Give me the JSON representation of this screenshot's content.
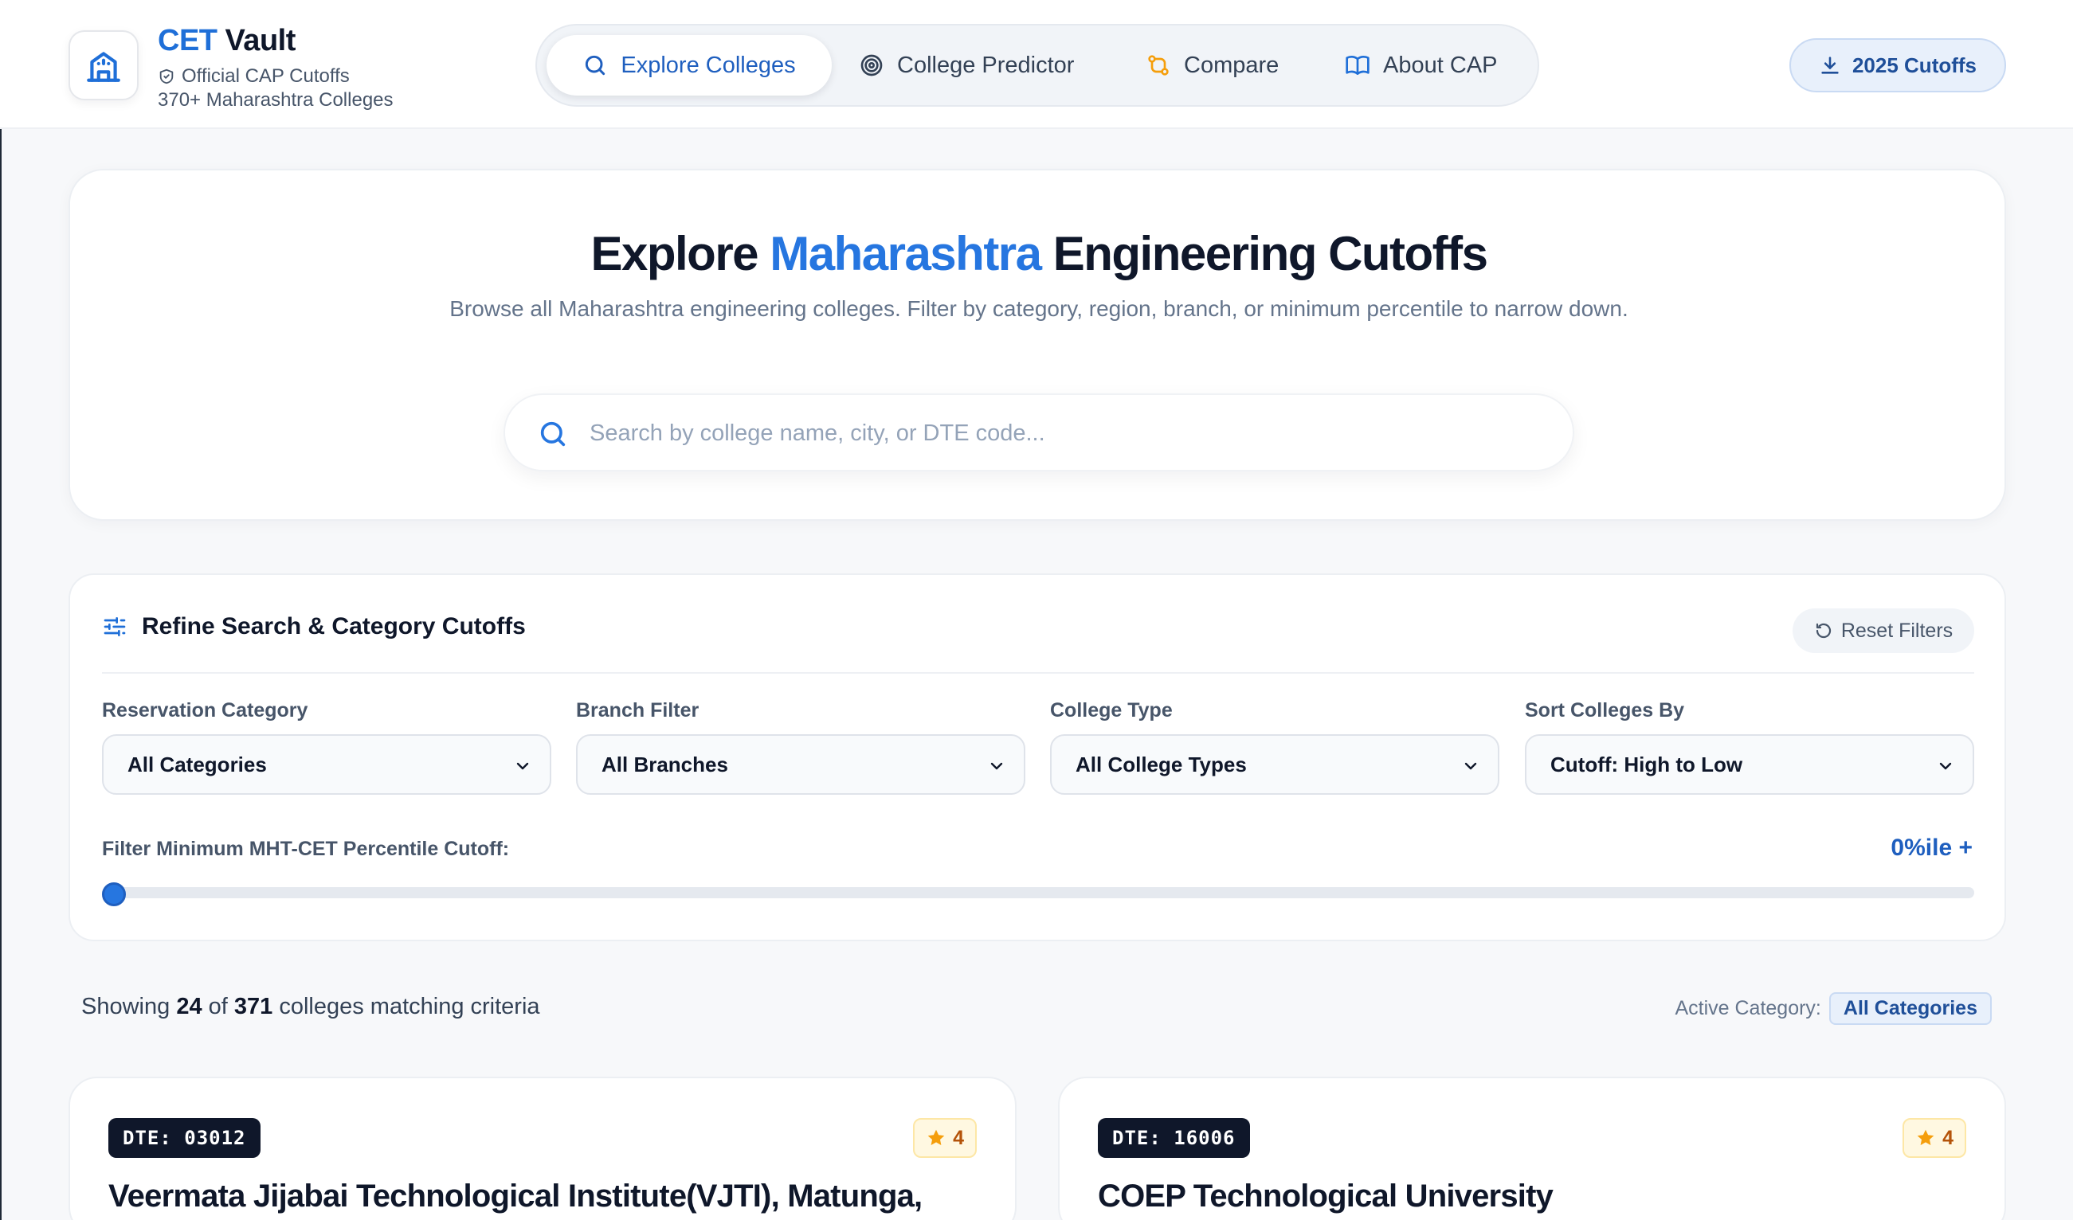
{
  "header": {
    "brand_accent": "CET",
    "brand_rest": " Vault",
    "subtitle": "Official CAP Cutoffs",
    "count_text": "370+ Maharashtra Colleges",
    "nav": [
      {
        "label": "Explore Colleges",
        "icon": "search-icon"
      },
      {
        "label": "College Predictor",
        "icon": "target-icon"
      },
      {
        "label": "Compare",
        "icon": "compare-icon"
      },
      {
        "label": "About CAP",
        "icon": "book-icon"
      }
    ],
    "cutoffs_button": "2025 Cutoffs"
  },
  "hero": {
    "title_pre": "Explore ",
    "title_accent": "Maharashtra",
    "title_post": " Engineering Cutoffs",
    "description": "Browse all Maharashtra engineering colleges. Filter by category, region, branch, or minimum percentile to narrow down.",
    "search_placeholder": "Search by college name, city, or DTE code..."
  },
  "filters": {
    "heading": "Refine Search & Category Cutoffs",
    "reset_label": "Reset Filters",
    "fields": [
      {
        "label": "Reservation Category",
        "value": "All Categories"
      },
      {
        "label": "Branch Filter",
        "value": "All Branches"
      },
      {
        "label": "College Type",
        "value": "All College Types"
      },
      {
        "label": "Sort Colleges By",
        "value": "Cutoff: High to Low"
      }
    ],
    "percentile_label": "Filter Minimum MHT-CET Percentile Cutoff:",
    "percentile_value_text": "0%ile +",
    "percentile_fraction": 0
  },
  "results": {
    "prefix": "Showing ",
    "shown": "24",
    "of": " of ",
    "total": "371",
    "suffix": " colleges matching criteria",
    "active_label": "Active Category:",
    "active_value": "All Categories"
  },
  "colleges": [
    {
      "dte": "DTE: 03012",
      "rating": "4",
      "name": "Veermata Jijabai Technological Institute(VJTI), Matunga,"
    },
    {
      "dte": "DTE: 16006",
      "rating": "4",
      "name": "COEP Technological University"
    }
  ],
  "colors": {
    "accent": "#2676e0",
    "accent_dark": "#1f5fbf",
    "dark": "#0f172a",
    "star": "#f59e0b"
  }
}
